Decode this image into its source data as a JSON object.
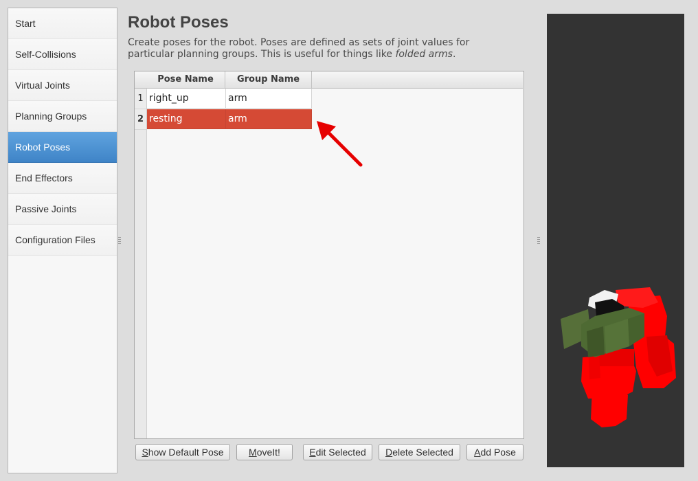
{
  "sidebar": {
    "items": [
      {
        "label": "Start"
      },
      {
        "label": "Self-Collisions"
      },
      {
        "label": "Virtual Joints"
      },
      {
        "label": "Planning Groups"
      },
      {
        "label": "Robot Poses",
        "active": true
      },
      {
        "label": "End Effectors"
      },
      {
        "label": "Passive Joints"
      },
      {
        "label": "Configuration Files"
      }
    ]
  },
  "main": {
    "title": "Robot Poses",
    "description_plain": "Create poses for the robot. Poses are defined as sets of joint values for particular planning groups. This is useful for things like ",
    "description_italic": "folded arms",
    "description_end": "."
  },
  "table": {
    "headers": [
      "Pose Name",
      "Group Name"
    ],
    "rows": [
      {
        "num": "1",
        "pose": "right_up",
        "group": "arm"
      },
      {
        "num": "2",
        "pose": "resting",
        "group": "arm",
        "selected": true
      }
    ]
  },
  "buttons": {
    "show_default_first": "S",
    "show_default_rest": "how Default Pose",
    "moveit_first": "M",
    "moveit_rest": "oveIt!",
    "edit_first": "E",
    "edit_rest": "dit Selected",
    "delete_first": "D",
    "delete_rest": "elete Selected",
    "add_first": "A",
    "add_rest": "dd Pose"
  },
  "colors": {
    "accent": "#4a90d9",
    "selection": "#d54a35",
    "annotation_arrow": "#e60000",
    "robot_body": "#ff0000",
    "robot_arm": "#4e6a33"
  },
  "icons": {
    "annotation": "red-arrow-icon",
    "splitter": "splitter-handle-icon"
  }
}
